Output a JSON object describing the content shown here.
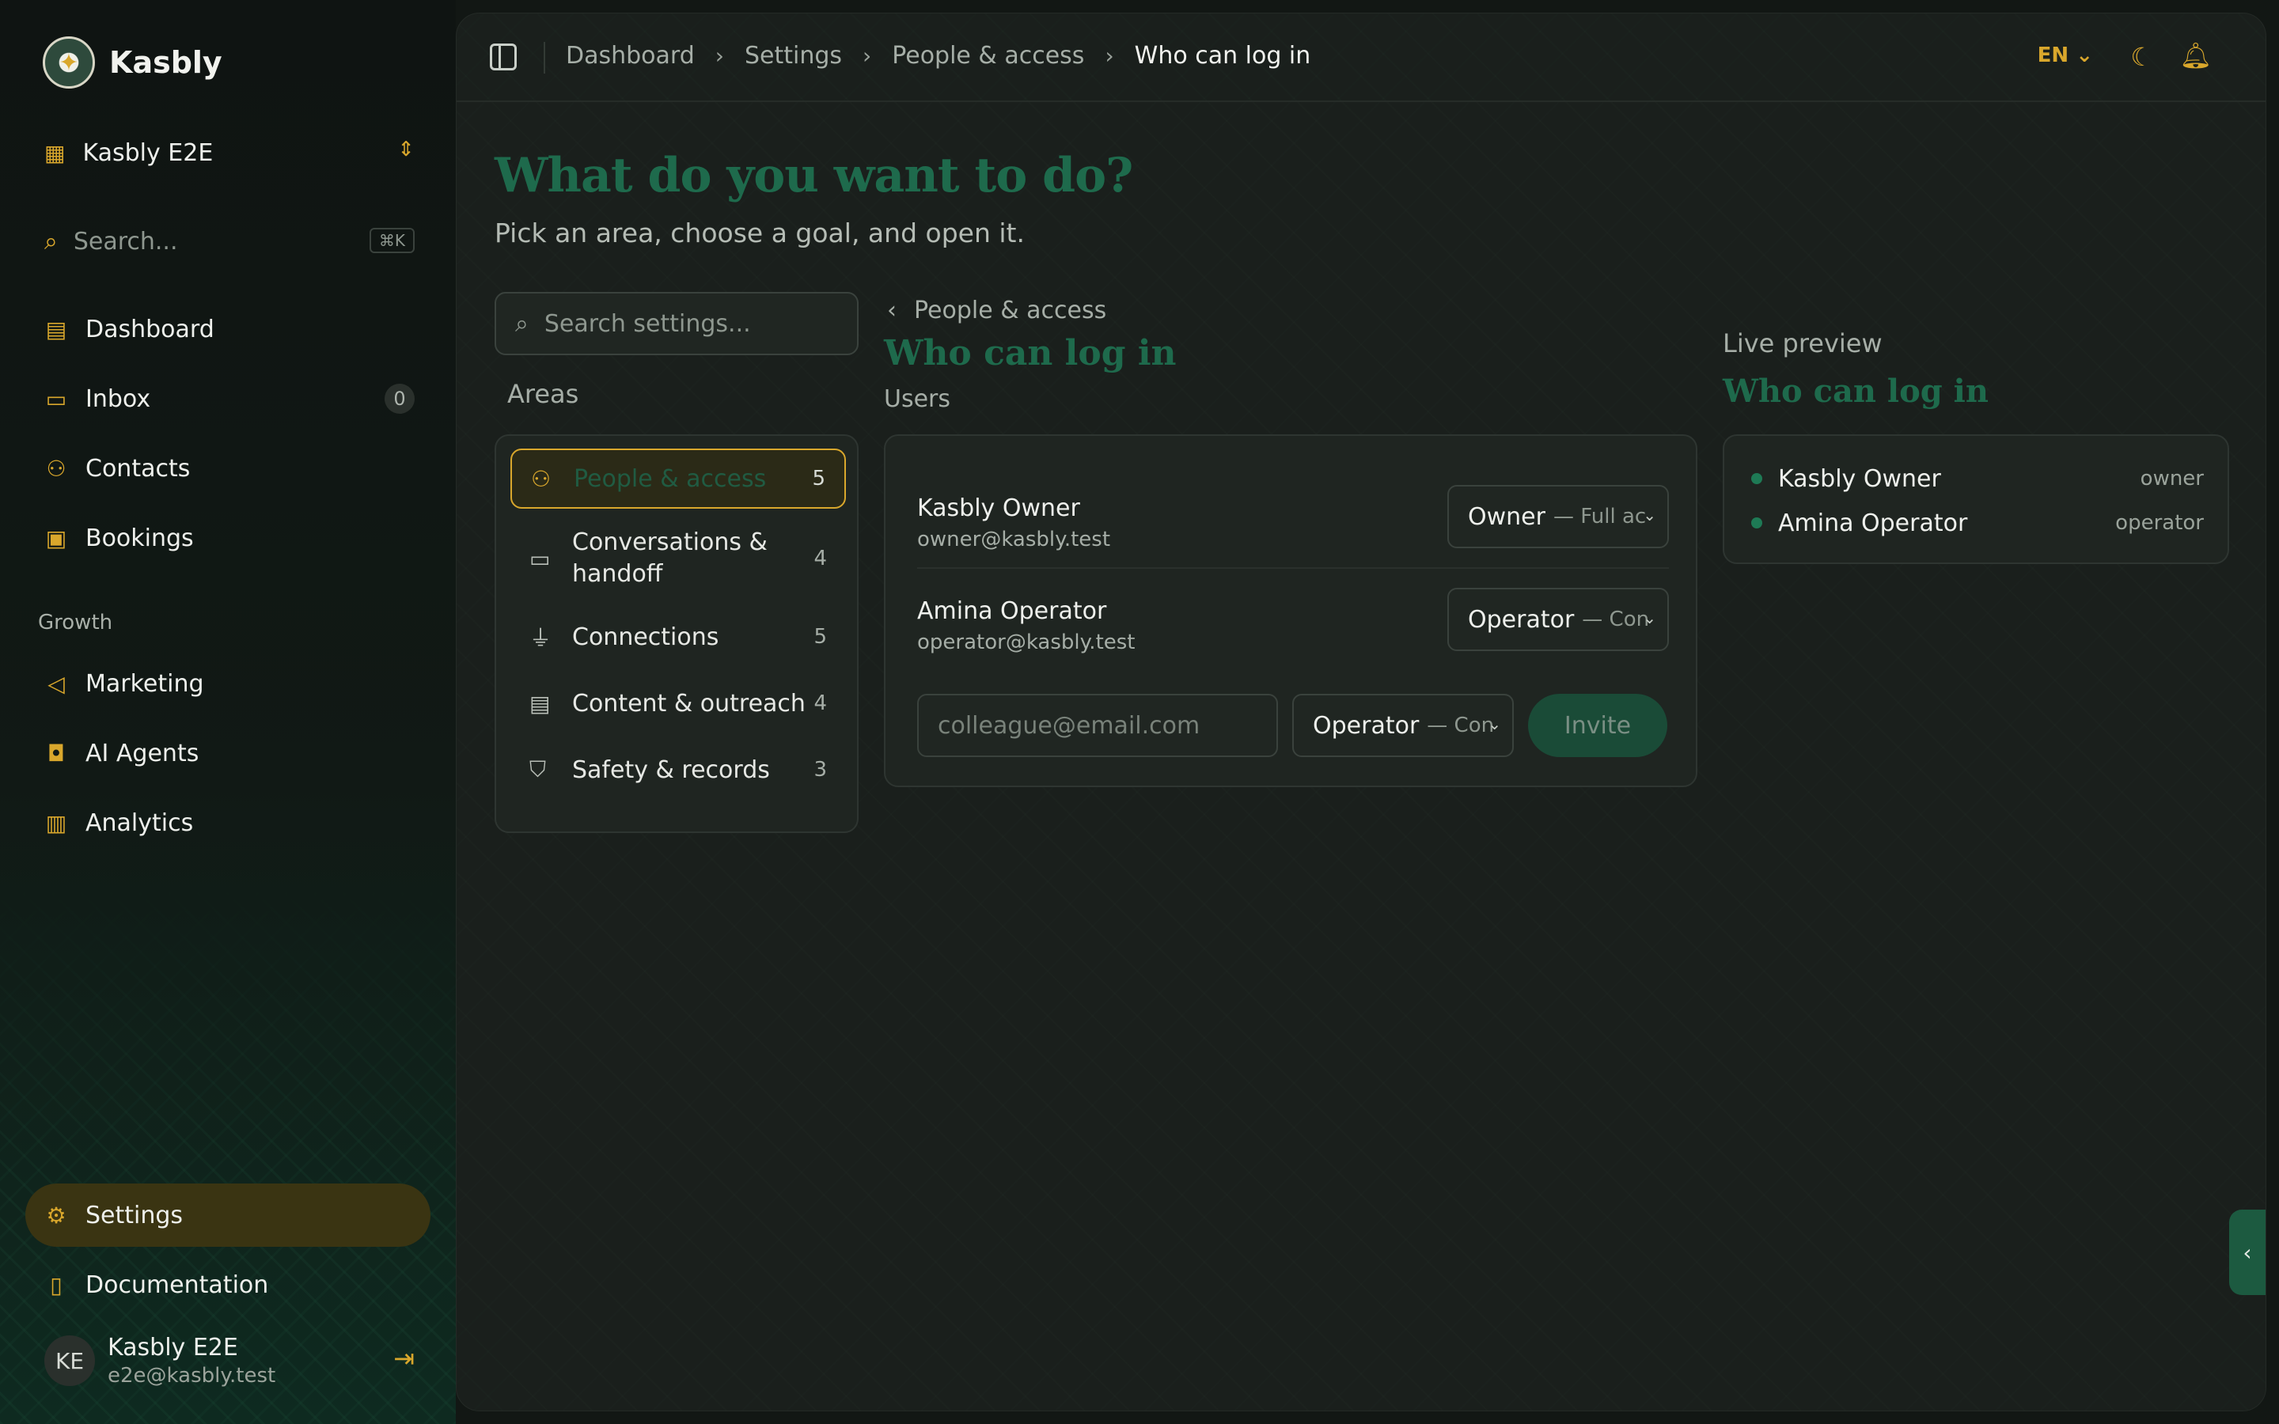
{
  "app": {
    "name": "Kasbly"
  },
  "workspace": {
    "name": "Kasbly E2E"
  },
  "sidebar": {
    "search_placeholder": "Search...",
    "search_shortcut": "⌘K",
    "items": [
      {
        "label": "Dashboard",
        "icon": "dashboard-icon"
      },
      {
        "label": "Inbox",
        "icon": "inbox-icon",
        "badge": "0"
      },
      {
        "label": "Contacts",
        "icon": "contacts-icon"
      },
      {
        "label": "Bookings",
        "icon": "calendar-icon"
      }
    ],
    "group_label": "Growth",
    "growth_items": [
      {
        "label": "Marketing",
        "icon": "megaphone-icon"
      },
      {
        "label": "AI Agents",
        "icon": "bot-icon"
      },
      {
        "label": "Analytics",
        "icon": "bar-chart-icon"
      }
    ],
    "settings_label": "Settings",
    "documentation_label": "Documentation",
    "user": {
      "initials": "KE",
      "name": "Kasbly E2E",
      "email": "e2e@kasbly.test"
    }
  },
  "topbar": {
    "breadcrumbs": [
      "Dashboard",
      "Settings",
      "People & access",
      "Who can log in"
    ],
    "language": "EN"
  },
  "page": {
    "title": "What do you want to do?",
    "subtitle": "Pick an area, choose a goal, and open it.",
    "settings_search_placeholder": "Search settings...",
    "areas_label": "Areas",
    "areas": [
      {
        "label": "People & access",
        "count": "5",
        "icon": "users-icon",
        "active": true
      },
      {
        "label": "Conversations & handoff",
        "count": "4",
        "icon": "chat-icon"
      },
      {
        "label": "Connections",
        "count": "5",
        "icon": "plug-icon"
      },
      {
        "label": "Content & outreach",
        "count": "4",
        "icon": "document-icon"
      },
      {
        "label": "Safety & records",
        "count": "3",
        "icon": "shield-icon"
      }
    ]
  },
  "section": {
    "back_label": "People & access",
    "title": "Who can log in",
    "subtitle": "Users",
    "users": [
      {
        "name": "Kasbly Owner",
        "email": "owner@kasbly.test",
        "role": "Owner",
        "role_desc": "— Full ac"
      },
      {
        "name": "Amina Operator",
        "email": "operator@kasbly.test",
        "role": "Operator",
        "role_desc": "— Con"
      }
    ],
    "invite": {
      "email_placeholder": "colleague@email.com",
      "role": "Operator",
      "role_desc": "— Con",
      "button": "Invite"
    }
  },
  "preview": {
    "label": "Live preview",
    "title": "Who can log in",
    "rows": [
      {
        "name": "Kasbly Owner",
        "role": "owner"
      },
      {
        "name": "Amina Operator",
        "role": "operator"
      }
    ]
  },
  "colors": {
    "accent": "#d9a72c",
    "brand_green": "#1e6a4c",
    "bg": "#121714"
  }
}
